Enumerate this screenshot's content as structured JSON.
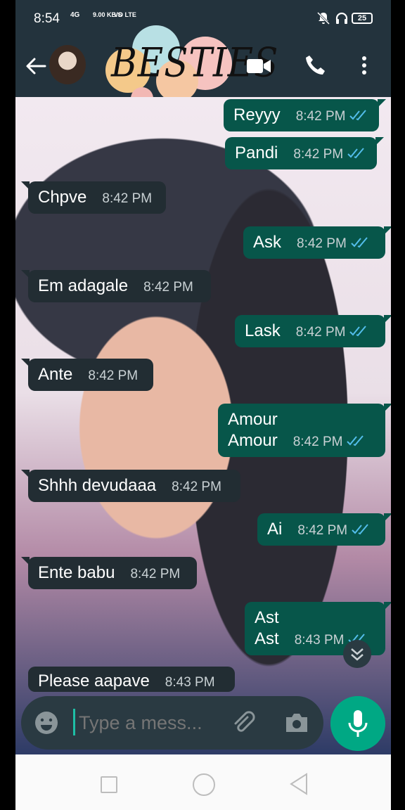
{
  "status_bar": {
    "time": "8:54",
    "network": "4G",
    "speed": "9.00 KB/S",
    "volte": "VO LTE",
    "battery": "25"
  },
  "header": {
    "title": "BESTIES"
  },
  "messages": [
    {
      "direction": "out",
      "text": "Reyyy",
      "time": "8:42 PM",
      "read": true
    },
    {
      "direction": "out",
      "text": "Pandi",
      "time": "8:42 PM",
      "read": true
    },
    {
      "direction": "in",
      "text": "Chpve",
      "time": "8:42 PM"
    },
    {
      "direction": "out",
      "text": "Ask",
      "time": "8:42 PM",
      "read": true
    },
    {
      "direction": "in",
      "text": "Em adagale",
      "time": "8:42 PM"
    },
    {
      "direction": "out",
      "text": "Lask",
      "time": "8:42 PM",
      "read": true
    },
    {
      "direction": "in",
      "text": "Ante",
      "time": "8:42 PM"
    },
    {
      "direction": "out",
      "text": "Amour\nAmour",
      "time": "8:42 PM",
      "read": true
    },
    {
      "direction": "in",
      "text": "Shhh devudaaa",
      "time": "8:42 PM"
    },
    {
      "direction": "out",
      "text": "Ai",
      "time": "8:42 PM",
      "read": true
    },
    {
      "direction": "in",
      "text": "Ente babu",
      "time": "8:42 PM"
    },
    {
      "direction": "out",
      "text": "Ast\nAst",
      "time": "8:43 PM",
      "read": true
    },
    {
      "direction": "in",
      "text": "Please aapave",
      "time": "8:43 PM"
    }
  ],
  "composer": {
    "placeholder": "Type a mess..."
  },
  "colors": {
    "header": "#23333d",
    "incoming_bubble": "#222d33",
    "outgoing_bubble": "#07564a",
    "read_ticks": "#53bdeb",
    "mic_button": "#00a884"
  }
}
